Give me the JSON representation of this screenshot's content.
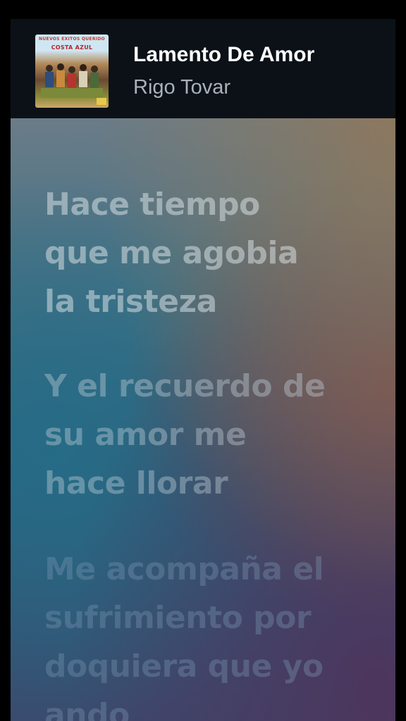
{
  "now_playing": {
    "title": "Lamento De Amor",
    "artist": "Rigo Tovar"
  },
  "album_art": {
    "top_text": "NUEVOS ÉXITOS QUERIDO",
    "band_text": "COSTA AZUL"
  },
  "lyrics": [
    {
      "lines": [
        "Hace tiempo",
        "que me agobia",
        "la tristeza"
      ]
    },
    {
      "lines": [
        "Y el recuerdo de",
        "su amor me",
        "hace llorar"
      ]
    },
    {
      "lines": [
        "Me acompaña el",
        "sufrimiento por",
        "doquiera que yo",
        "ando"
      ]
    }
  ],
  "colors": {
    "header_bg": "#0b1117",
    "title": "#ffffff",
    "artist": "#aab1b8"
  }
}
